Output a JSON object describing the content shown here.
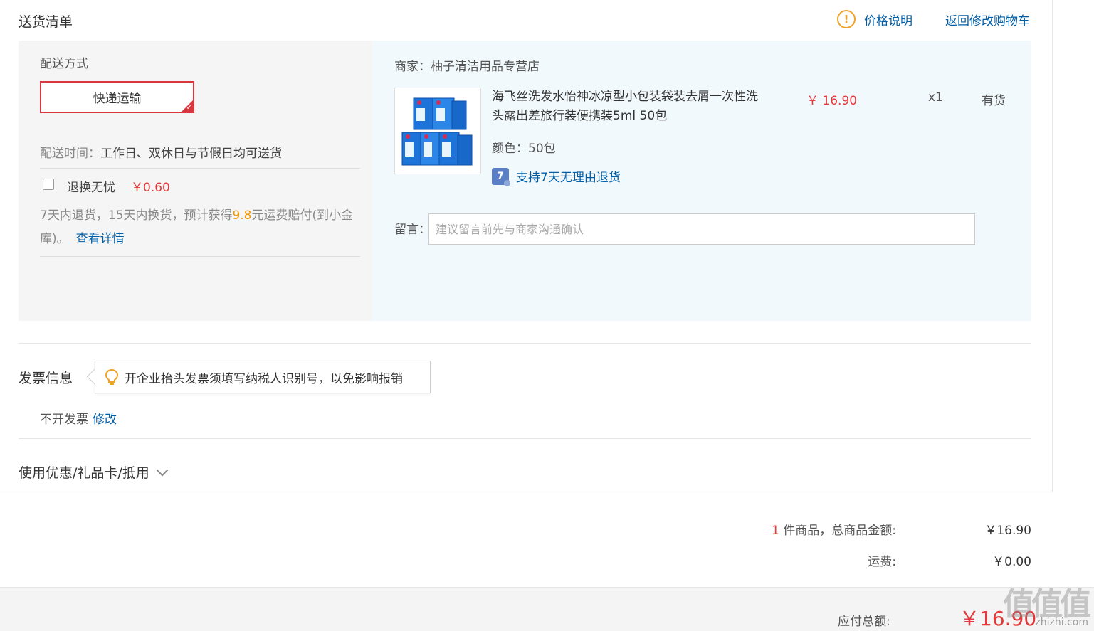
{
  "delivery": {
    "title": "送货清单",
    "price_note": "价格说明",
    "back_to_cart": "返回修改购物车",
    "method_label": "配送方式",
    "method_value": "快递运输",
    "time_label": "配送时间：",
    "time_value": "工作日、双休日与节假日均可送货",
    "insurance_label": "退换无忧",
    "insurance_price": "￥0.60",
    "insurance_desc_1": "7天内退货，15天内换货，预计获得",
    "insurance_amount": "9.8",
    "insurance_desc_2": "元运费赔付(到小金库)。",
    "insurance_link": "查看详情"
  },
  "order": {
    "merchant": "商家：柚子清洁用品专营店",
    "product_name": "海飞丝洗发水怡神冰凉型小包装袋装去屑一次性洗头露出差旅行装便携装5ml 50包",
    "price": "￥ 16.90",
    "quantity": "x1",
    "stock": "有货",
    "color": "颜色：50包",
    "return_policy": "支持7天无理由退货",
    "return_icon_text": "7",
    "message_label": "留言：",
    "message_placeholder": "建议留言前先与商家沟通确认"
  },
  "invoice": {
    "title": "发票信息",
    "tip": "开企业抬头发票须填写纳税人识别号，以免影响报销",
    "status": "不开发票",
    "edit": "修改"
  },
  "coupon": {
    "title": "使用优惠/礼品卡/抵用"
  },
  "summary": {
    "item_count": "1",
    "items_label": "件商品，总商品金额:",
    "items_total": "￥16.90",
    "shipping_label": "运费:",
    "shipping_value": "￥0.00",
    "total_label": "应付总额:",
    "total_value": "￥16.90"
  },
  "watermark": {
    "logo": "值值值",
    "url": "zhizhi.com"
  },
  "colors": {
    "accent_red": "#e4393c",
    "link_blue": "#005ea7",
    "orange": "#f39800",
    "panel_grey": "#f5f5f5",
    "panel_blue": "#f2f9fd"
  }
}
